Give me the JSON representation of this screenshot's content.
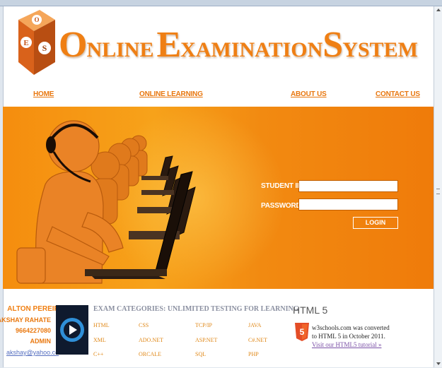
{
  "header": {
    "title_words": [
      {
        "cap": "O",
        "rest": "NLINE"
      },
      {
        "cap": "E",
        "rest": "XAMINATION"
      },
      {
        "cap": "S",
        "rest": "YSTEM"
      }
    ],
    "logo_letters": [
      "O",
      "E",
      "S"
    ]
  },
  "nav": {
    "home": "HOME",
    "online_learning": "ONLINE LEARNING",
    "about": "ABOUT US",
    "contact": "CONTACT US"
  },
  "login": {
    "student_id_label": "STUDENT ID",
    "password_label": "PASSWORD",
    "student_id_value": "",
    "password_value": "",
    "button_label": "LOGIN"
  },
  "admin": {
    "name": "ALTON PEREIRA",
    "line1": "AKSHAY RAHATE",
    "line2": "9664227080",
    "line3": "ADMIN",
    "email": "akshay@yahoo.co"
  },
  "categories": {
    "title": "EXAM CATEGORIES: UNLIMITED TESTING FOR LEARNING",
    "items": [
      "HTML",
      "CSS",
      "TCP/IP",
      "JAVA",
      "XML",
      "ADO.NET",
      "ASP.NET",
      "C#.NET",
      "C++",
      "ORCALE",
      "SQL",
      "PHP"
    ]
  },
  "html5": {
    "title": "HTML 5",
    "text": "w3schools.com was converted to HTML 5 in October 2011.",
    "link": "Visit our HTML5 tutorial »",
    "shield_number": "5"
  },
  "colors": {
    "brand_orange": "#ef7f14",
    "banner_orange": "#f58d0e",
    "link_purple": "#7a4fa6"
  }
}
